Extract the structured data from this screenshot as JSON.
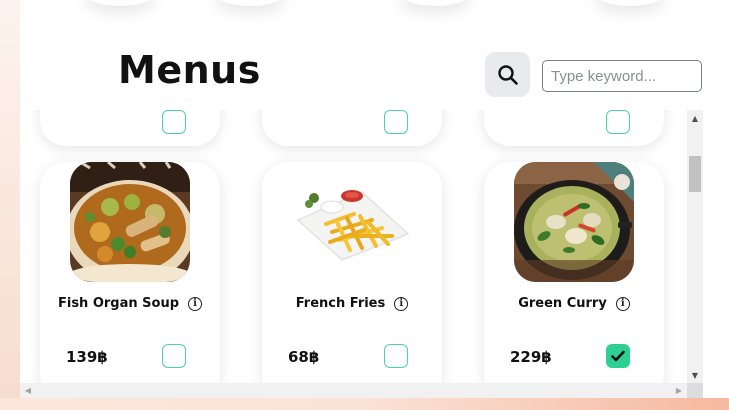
{
  "header": {
    "title": "Menus",
    "search_icon": "search-icon",
    "search_placeholder": "Type keyword..."
  },
  "menu_items": [
    {
      "name": "Fish Organ Soup",
      "price": "139฿",
      "selected": false,
      "info_icon": "info-icon",
      "image": "bowl of yellow curry soup with vegetables and fish"
    },
    {
      "name": "French Fries",
      "price": "68฿",
      "selected": false,
      "info_icon": "info-icon",
      "image": "plate of french fries with dipping sauces"
    },
    {
      "name": "Green Curry",
      "price": "229฿",
      "selected": true,
      "info_icon": "info-icon",
      "image": "black bowl of green curry with chili and basil"
    }
  ],
  "colors": {
    "checkbox_border": "#4cd3a6",
    "checkbox_checked": "#2ecf93",
    "search_button_bg": "#e9eaee",
    "title": "#111111"
  }
}
